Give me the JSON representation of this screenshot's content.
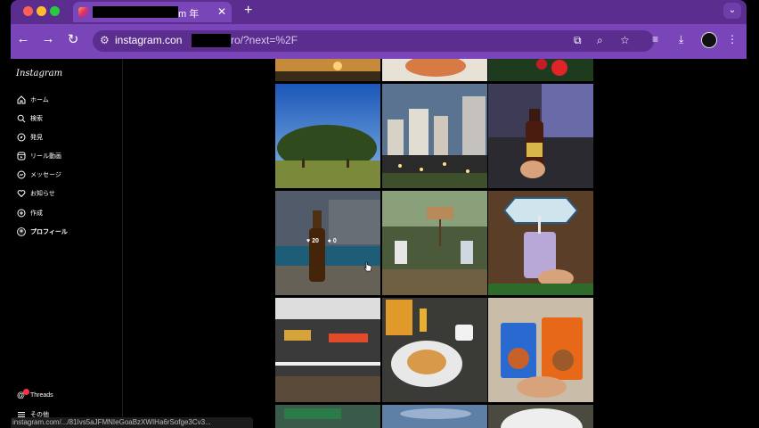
{
  "browser": {
    "tab_title": "m 年",
    "url_host": "instagram.con",
    "url_rest": "ro/?next=%2F",
    "accent": "#7a45b8"
  },
  "sidebar": {
    "logo": "Instagram",
    "items": [
      {
        "label": "ホーム",
        "icon": "home-icon"
      },
      {
        "label": "検索",
        "icon": "search-icon"
      },
      {
        "label": "発見",
        "icon": "compass-icon"
      },
      {
        "label": "リール動画",
        "icon": "reels-icon"
      },
      {
        "label": "メッセージ",
        "icon": "messenger-icon"
      },
      {
        "label": "お知らせ",
        "icon": "heart-icon"
      },
      {
        "label": "作成",
        "icon": "plus-icon"
      },
      {
        "label": "プロフィール",
        "icon": "avatar-icon"
      }
    ],
    "threads": "Threads",
    "more": "その他"
  },
  "hover_post": {
    "likes": "20",
    "comments": "0"
  },
  "status_bar": "instagram.com/.../81Ivs5aJFMNIeGoaBzXWIHa6rSofge3Cv3..."
}
